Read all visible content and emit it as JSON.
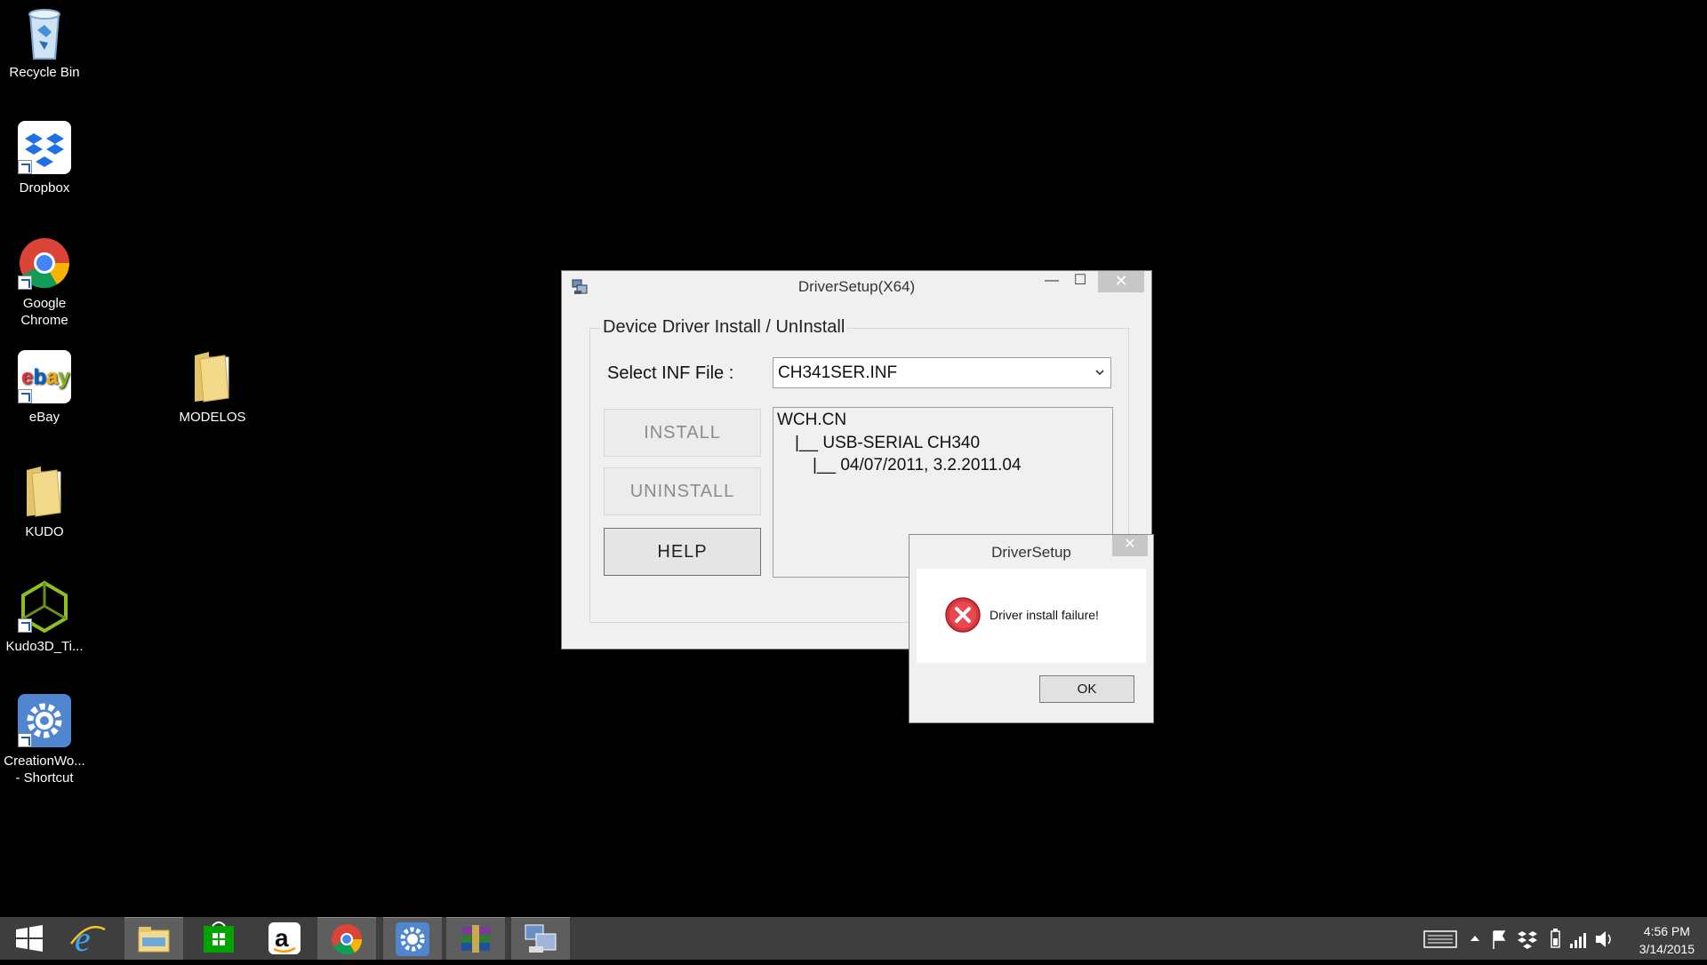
{
  "desktop": {
    "icons": [
      {
        "label": "Recycle Bin"
      },
      {
        "label": "Dropbox"
      },
      {
        "label": "Google Chrome"
      },
      {
        "label": "eBay"
      },
      {
        "label": "MODELOS"
      },
      {
        "label": "KUDO"
      },
      {
        "label": "Kudo3D_Ti..."
      },
      {
        "label": "CreationWo... - Shortcut"
      }
    ]
  },
  "main_window": {
    "title": "DriverSetup(X64)",
    "group_title": "Device Driver Install / UnInstall",
    "inf_label": "Select INF File :",
    "inf_value": "CH341SER.INF",
    "buttons": {
      "install": "INSTALL",
      "uninstall": "UNINSTALL",
      "help": "HELP"
    },
    "tree": [
      "WCH.CN",
      "|__ USB-SERIAL CH340",
      "|__ 04/07/2011, 3.2.2011.04"
    ],
    "controls": {
      "minimize": "—",
      "maximize": "☐",
      "close": "✕"
    }
  },
  "dialog": {
    "title": "DriverSetup",
    "message": "Driver install failure!",
    "ok_label": "OK",
    "close": "✕"
  },
  "taskbar": {
    "apps": [
      "start",
      "internet-explorer",
      "file-explorer",
      "store",
      "amazon",
      "chrome",
      "creationworkshop",
      "winrar",
      "driversetup"
    ],
    "clock_time": "4:56 PM",
    "clock_date": "3/14/2015"
  },
  "colors": {
    "desktop": "#000000",
    "taskbar": "#3e3e3e",
    "error_red": "#d9363e"
  }
}
